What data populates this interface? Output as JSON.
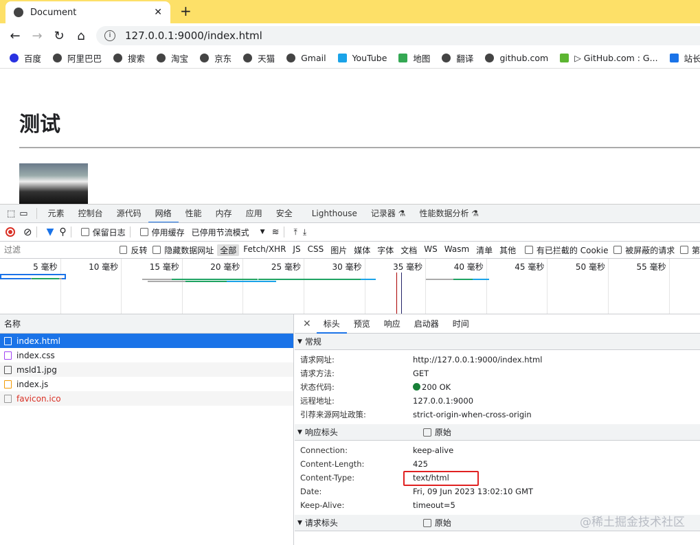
{
  "browser": {
    "tab_title": "Document",
    "url": "127.0.0.1:9000/index.html",
    "bookmarks": [
      "百度",
      "阿里巴巴",
      "搜索",
      "淘宝",
      "京东",
      "天猫",
      "Gmail",
      "YouTube",
      "地图",
      "翻译",
      "github.com",
      "▷ GitHub.com : G...",
      "站长"
    ]
  },
  "page": {
    "heading": "测试"
  },
  "devtools": {
    "tabs": [
      "元素",
      "控制台",
      "源代码",
      "网络",
      "性能",
      "内存",
      "应用",
      "安全",
      "Lighthouse",
      "记录器 ⚗",
      "性能数据分析 ⚗"
    ],
    "active_tab": "网络",
    "toolbar": {
      "preserve_log": "保留日志",
      "disable_cache": "停用缓存",
      "throttle": "已停用节流模式"
    },
    "filter": {
      "placeholder": "过滤",
      "invert": "反转",
      "hide_data_urls": "隐藏数据网址",
      "types": [
        "全部",
        "Fetch/XHR",
        "JS",
        "CSS",
        "图片",
        "媒体",
        "字体",
        "文档",
        "WS",
        "Wasm",
        "清单",
        "其他"
      ],
      "blocked_cookies": "有已拦截的 Cookie",
      "blocked_requests": "被屏蔽的请求",
      "third_party": "第"
    },
    "timeline_ticks": [
      "5 毫秒",
      "10 毫秒",
      "15 毫秒",
      "20 毫秒",
      "25 毫秒",
      "30 毫秒",
      "35 毫秒",
      "40 毫秒",
      "45 毫秒",
      "50 毫秒",
      "55 毫秒"
    ],
    "list_header": "名称",
    "files": [
      {
        "name": "index.html",
        "type": "document",
        "selected": true
      },
      {
        "name": "index.css",
        "type": "stylesheet"
      },
      {
        "name": "msld1.jpg",
        "type": "image"
      },
      {
        "name": "index.js",
        "type": "script"
      },
      {
        "name": "favicon.ico",
        "type": "other",
        "error": true
      }
    ],
    "detail_tabs": [
      "标头",
      "预览",
      "响应",
      "启动器",
      "时间"
    ],
    "general": {
      "title": "常规",
      "rows": [
        [
          "请求网址:",
          "http://127.0.0.1:9000/index.html"
        ],
        [
          "请求方法:",
          "GET"
        ],
        [
          "状态代码:",
          "200 OK"
        ],
        [
          "远程地址:",
          "127.0.0.1:9000"
        ],
        [
          "引荐来源网址政策:",
          "strict-origin-when-cross-origin"
        ]
      ]
    },
    "response_headers": {
      "title": "响应标头",
      "raw": "原始",
      "rows": [
        [
          "Connection:",
          "keep-alive"
        ],
        [
          "Content-Length:",
          "425"
        ],
        [
          "Content-Type:",
          "text/html"
        ],
        [
          "Date:",
          "Fri, 09 Jun 2023 13:02:10 GMT"
        ],
        [
          "Keep-Alive:",
          "timeout=5"
        ]
      ]
    },
    "request_headers": {
      "title": "请求标头",
      "raw": "原始"
    }
  },
  "watermark": "@稀土掘金技术社区",
  "colors": {
    "tabbar": "#fde068",
    "accent": "#1a73e8",
    "status_ok": "#188038",
    "highlight": "#e02020"
  }
}
